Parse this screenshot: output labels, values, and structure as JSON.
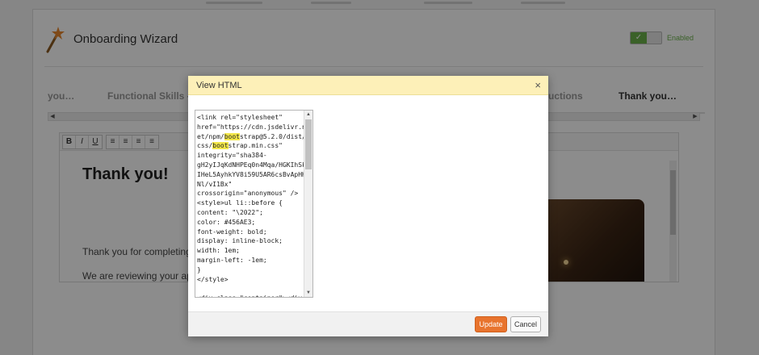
{
  "wizard": {
    "title": "Onboarding Wizard",
    "toggle_state": "✓",
    "toggle_label": "Enabled",
    "icon": "magic-wand-icon"
  },
  "tabs": [
    {
      "label": "you…"
    },
    {
      "label": "Functional Skills - V"
    },
    {
      "label": "uctions"
    },
    {
      "label": "Thank you…"
    }
  ],
  "editor": {
    "toolbar": [
      "B",
      "I",
      "U",
      "≡",
      "≡",
      "≡",
      "≡"
    ],
    "heading": "Thank you!",
    "paragraph1": "Thank you for completing",
    "paragraph2": "We are reviewing your ap"
  },
  "modal": {
    "title": "View HTML",
    "close": "×",
    "code": {
      "before_hl1": "<link rel=\"stylesheet\"\nhref=\"https://cdn.jsdelivr.n\net/npm/",
      "hl1": "boot",
      "mid": "strap@5.2.0/dist/\ncss/",
      "hl2": "boot",
      "after_hl2": "strap.min.css\"\nintegrity=\"sha384-\ngH2yIJqKdNHPEq0n4Mqa/HGKIhSk\nIHeL5AyhkYV8i59U5AR6csBvApHH\nNl/vI1Bx\"\ncrossorigin=\"anonymous\" />\n<style>ul li::before {\ncontent: \"\\2022\";\ncolor: #456AE3;\nfont-weight: bold;\ndisplay: inline-block;\nwidth: 1em;\nmargin-left: -1em;\n}\n</style>\n\n<div class=\"container\"><div"
    },
    "update_label": "Update",
    "cancel_label": "Cancel"
  }
}
